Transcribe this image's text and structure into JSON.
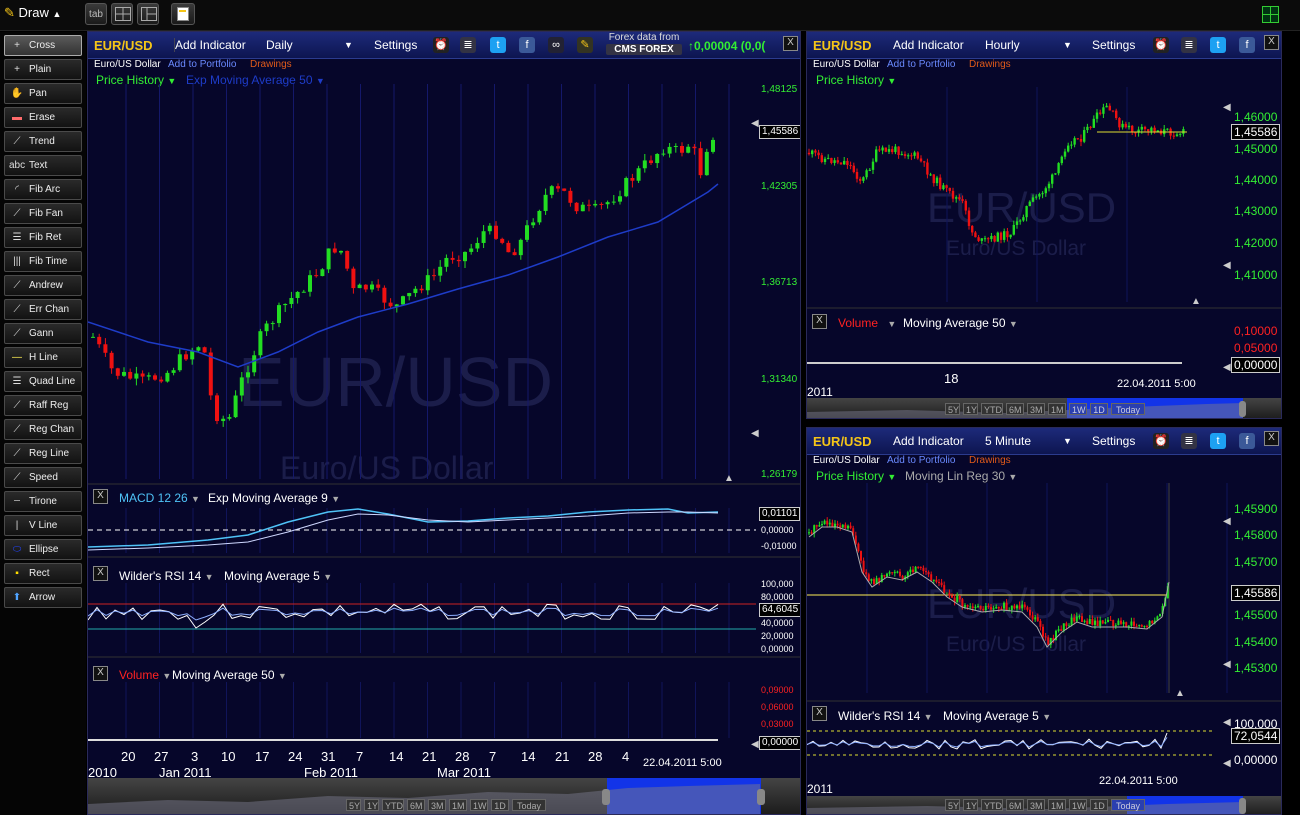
{
  "topbar": {
    "draw_label": "Draw",
    "tab_label": "tab"
  },
  "tools": [
    "Cross",
    "Plain",
    "Pan",
    "Erase",
    "Trend",
    "Text",
    "Fib Arc",
    "Fib Fan",
    "Fib Ret",
    "Fib Time",
    "Andrew",
    "Err Chan",
    "Gann",
    "H Line",
    "Quad Line",
    "Raff Reg",
    "Reg Chan",
    "Reg Line",
    "Speed",
    "Tirone",
    "V Line",
    "Ellipse",
    "Rect",
    "Arrow"
  ],
  "tool_icons": [
    "+",
    "+",
    "✋",
    "▬",
    "⟋",
    "abc",
    "◜",
    "⟋",
    "☰",
    "|||",
    "⟋",
    "⟋",
    "⟋",
    "—",
    "☰",
    "⟋",
    "⟋",
    "⟋",
    "⟋",
    "┄",
    "|",
    "⬭",
    "▪",
    "⬆"
  ],
  "colors": {
    "green": "#33ee33",
    "red": "#ff2222",
    "gold": "#f5c518",
    "blue": "#1e3cc8",
    "cyan": "#4fc3f7"
  },
  "main": {
    "symbol": "EUR/USD",
    "add_indicator": "Add Indicator",
    "interval": "Daily",
    "settings": "Settings",
    "forex_top": "Forex data from",
    "forex_brand": "CMS FOREX",
    "change": "↑0,00004 (0,0(",
    "name": "Euro/US Dollar",
    "add_portfolio": "Add to Portfolio",
    "drawings": "Drawings",
    "price_history": "Price History",
    "ema": "Exp Moving Average 50",
    "y_labels": [
      "1,48125",
      "1,42305",
      "1,36713",
      "1,31340",
      "1,26179"
    ],
    "last_price": "1,45586",
    "watermark_symbol": "EUR/USD",
    "watermark_name": "Euro/US Dollar",
    "macd": {
      "label": "MACD 12 26",
      "ema": "Exp Moving Average 9",
      "value": "0,01101",
      "levels": [
        "0,00000",
        "-0,01000"
      ]
    },
    "rsi": {
      "label": "Wilder's RSI 14",
      "ma": "Moving Average 5",
      "value": "64,6045",
      "levels": [
        "100,000",
        "80,0000",
        "40,0000",
        "20,0000",
        "0,00000"
      ]
    },
    "volume": {
      "label": "Volume",
      "ma": "Moving Average 50",
      "value": "0,00000",
      "levels": [
        "0,09000",
        "0,06000",
        "0,03000"
      ]
    },
    "x_days": [
      "20",
      "27",
      "3",
      "10",
      "17",
      "24",
      "31",
      "7",
      "14",
      "21",
      "28",
      "7",
      "14",
      "21",
      "28",
      "4"
    ],
    "x_months": [
      "2010",
      "Jan 2011",
      "Feb 2011",
      "Mar 2011"
    ],
    "timestamp": "22.04.2011 5:00",
    "ranges": [
      "5Y",
      "1Y",
      "YTD",
      "6M",
      "3M",
      "1M",
      "1W",
      "1D",
      "Today"
    ]
  },
  "hourly": {
    "symbol": "EUR/USD",
    "add_indicator": "Add Indicator",
    "interval": "Hourly",
    "settings": "Settings",
    "name": "Euro/US Dollar",
    "add_portfolio": "Add to Portfolio",
    "drawings": "Drawings",
    "price_history": "Price History",
    "y_labels": [
      "1,46000",
      "1,45000",
      "1,44000",
      "1,43000",
      "1,42000",
      "1,41000"
    ],
    "last_price": "1,45586",
    "watermark_symbol": "EUR/USD",
    "watermark_name": "Euro/US Dollar",
    "volume": {
      "label": "Volume",
      "ma": "Moving Average 50",
      "value": "0,00000",
      "levels": [
        "0,10000",
        "0,05000"
      ]
    },
    "x_day": "18",
    "x_year": "2011",
    "timestamp": "22.04.2011 5:00",
    "ranges": [
      "5Y",
      "1Y",
      "YTD",
      "6M",
      "3M",
      "1M",
      "1W",
      "1D",
      "Today"
    ]
  },
  "fivemin": {
    "symbol": "EUR/USD",
    "add_indicator": "Add Indicator",
    "interval": "5 Minute",
    "settings": "Settings",
    "name": "Euro/US Dollar",
    "add_portfolio": "Add to Portfolio",
    "drawings": "Drawings",
    "price_history": "Price History",
    "linreg": "Moving Lin Reg 30",
    "y_labels": [
      "1,45900",
      "1,45800",
      "1,45700",
      "1,45500",
      "1,45400",
      "1,45300"
    ],
    "last_price": "1,45586",
    "watermark_symbol": "EUR/USD",
    "watermark_name": "Euro/US Dollar",
    "rsi": {
      "label": "Wilder's RSI 14",
      "ma": "Moving Average 5",
      "value": "72,0544",
      "levels": [
        "100,000",
        "0,00000"
      ]
    },
    "x_year": "2011",
    "timestamp": "22.04.2011 5:00",
    "ranges": [
      "5Y",
      "1Y",
      "YTD",
      "6M",
      "3M",
      "1M",
      "1W",
      "1D",
      "Today"
    ]
  }
}
